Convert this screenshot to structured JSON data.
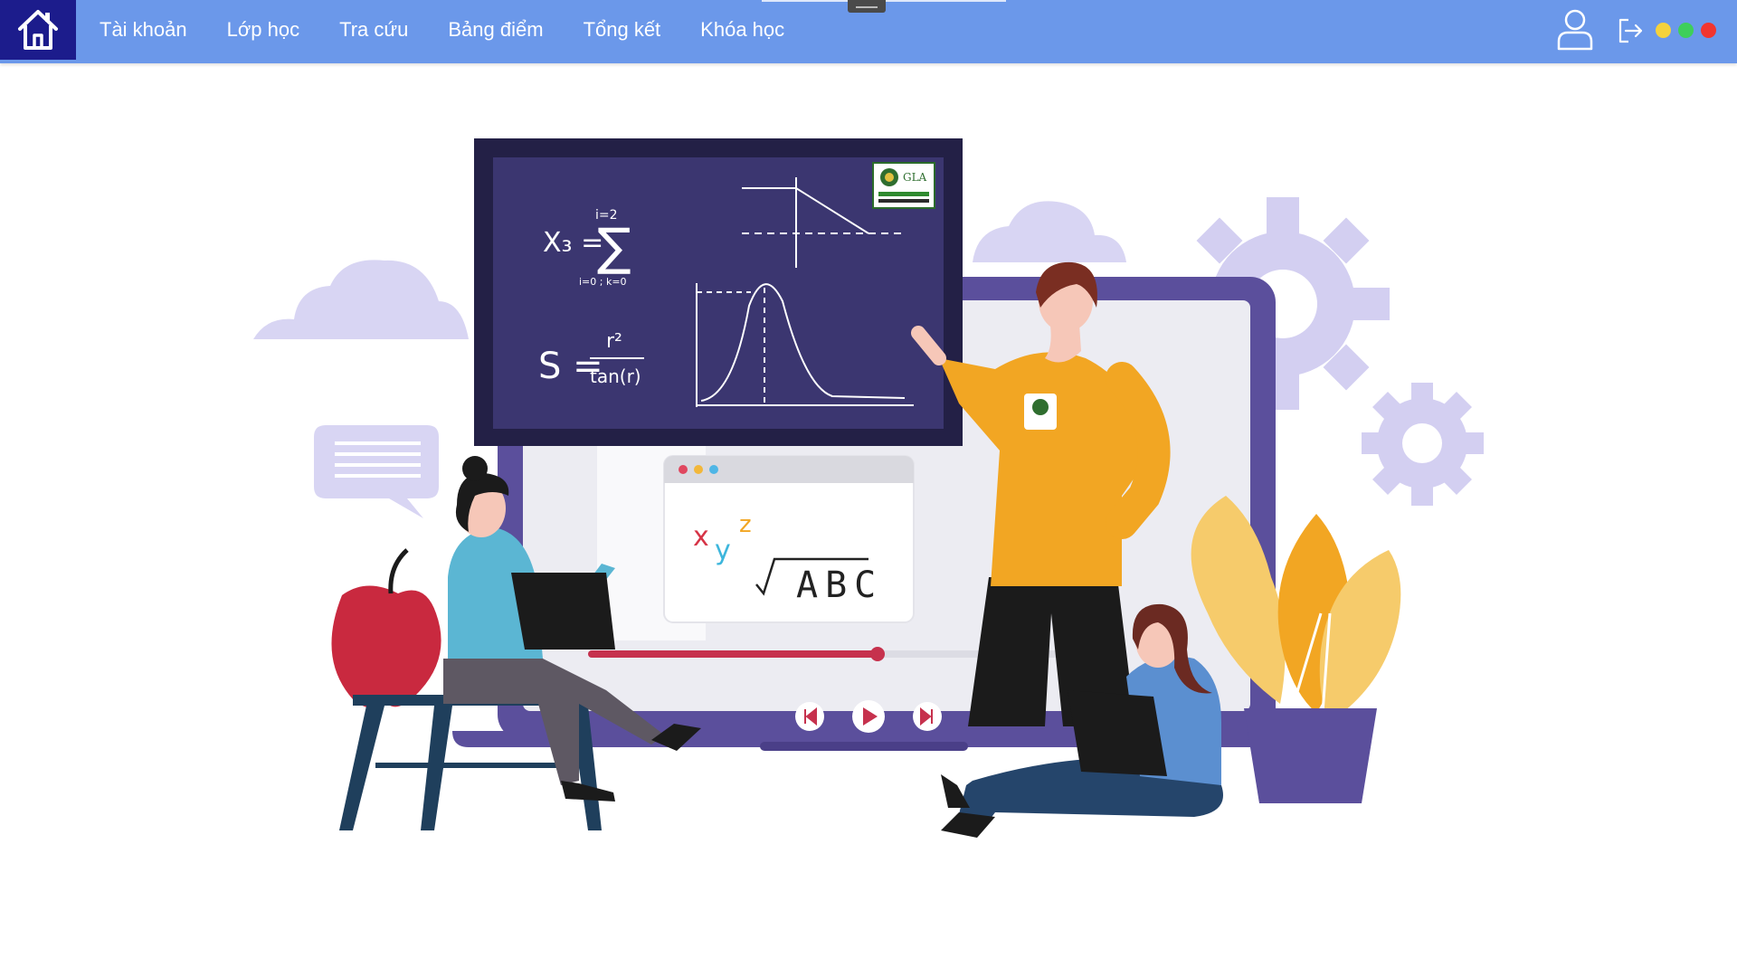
{
  "nav": {
    "items": [
      "Tài khoản",
      "Lớp học",
      "Tra cứu",
      "Bảng điểm",
      "Tổng kết",
      "Khóa học"
    ]
  },
  "icons": {
    "home": "home-icon",
    "user": "user-icon",
    "logout": "logout-icon"
  },
  "window_controls": {
    "colors": [
      "#f5d23c",
      "#3ecf5a",
      "#f2352f"
    ]
  },
  "hero": {
    "board_logo_text": "GLA",
    "board_formula_1": "X₃ =",
    "sum_top": "i=2",
    "sum_bottom": "i=0 ; k=0",
    "board_formula_2_lhs": "S =",
    "fraction_num": "r²",
    "fraction_den": "tan(r)",
    "window_letters": [
      "x",
      "y",
      "z"
    ],
    "window_text": "ABC"
  },
  "colors": {
    "topbar": "#6b98ea",
    "home_bg": "#1c1c8c",
    "board": "#3b3670",
    "laptop": "#5b4f9c",
    "accent_orange": "#f2a623"
  }
}
